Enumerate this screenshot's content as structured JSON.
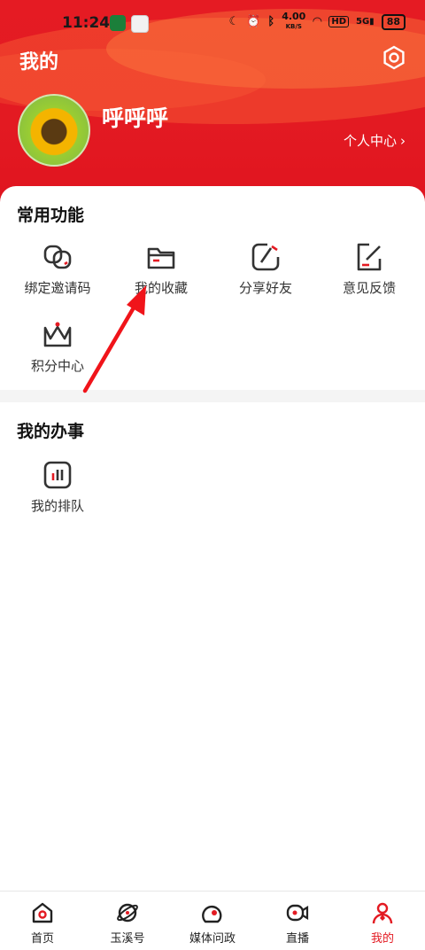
{
  "status_bar": {
    "time": "11:24",
    "net_speed": "4.00",
    "net_unit": "KB/S",
    "hd": "HD",
    "signal": "5G",
    "battery": "88"
  },
  "header": {
    "title": "我的",
    "username": "呼呼呼",
    "profile_link": "个人中心"
  },
  "common_functions": {
    "title": "常用功能",
    "items": [
      {
        "label": "绑定邀请码",
        "icon": "link-icon"
      },
      {
        "label": "我的收藏",
        "icon": "folder-icon"
      },
      {
        "label": "分享好友",
        "icon": "share-icon"
      },
      {
        "label": "意见反馈",
        "icon": "feedback-icon"
      },
      {
        "label": "积分中心",
        "icon": "crown-icon"
      }
    ]
  },
  "my_affairs": {
    "title": "我的办事",
    "items": [
      {
        "label": "我的排队",
        "icon": "queue-icon"
      }
    ]
  },
  "bottom_nav": {
    "items": [
      {
        "label": "首页",
        "icon": "home-icon"
      },
      {
        "label": "玉溪号",
        "icon": "planet-icon"
      },
      {
        "label": "媒体问政",
        "icon": "media-icon"
      },
      {
        "label": "直播",
        "icon": "live-icon"
      },
      {
        "label": "我的",
        "icon": "profile-icon",
        "active": true
      }
    ]
  },
  "colors": {
    "brand": "#e31a22",
    "text": "#333333"
  }
}
